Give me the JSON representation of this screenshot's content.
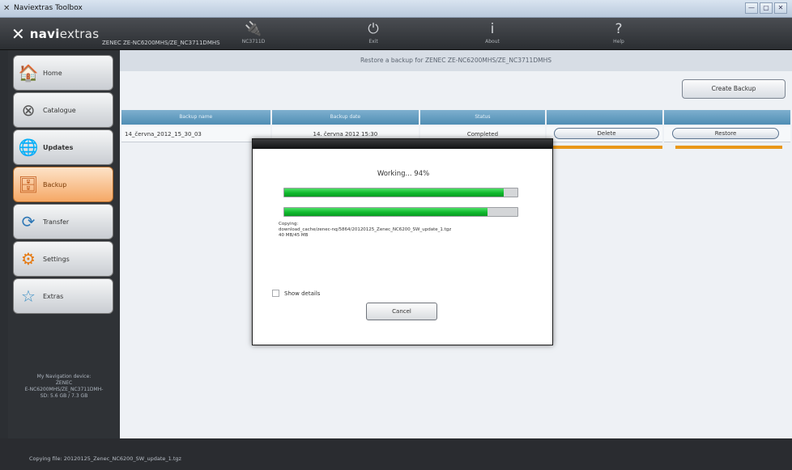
{
  "window": {
    "title": "Naviextras Toolbox",
    "min": "—",
    "max": "▢",
    "close": "✕"
  },
  "topbar": {
    "logo_prefix": "navi",
    "logo_suffix": "extras",
    "device_name": "ZENEC ZE-NC6200MHS/ZE_NC3711DMHS",
    "items": [
      {
        "icon": "plug-icon",
        "glyph": "🔌",
        "label": "NC3711D"
      },
      {
        "icon": "exit-icon",
        "glyph": "⏻",
        "label": "Exit"
      },
      {
        "icon": "info-icon",
        "glyph": "i",
        "label": "About"
      },
      {
        "icon": "help-icon",
        "glyph": "?",
        "label": "Help"
      }
    ]
  },
  "sidebar": {
    "items": [
      {
        "name": "home",
        "glyph": "🏠",
        "label": "Home",
        "active": false
      },
      {
        "name": "catalogue",
        "glyph": "⊗",
        "label": "Catalogue",
        "active": false
      },
      {
        "name": "updates",
        "glyph": "🌐",
        "label": "Updates",
        "active": false
      },
      {
        "name": "backup",
        "glyph": "🗄",
        "label": "Backup",
        "active": true
      },
      {
        "name": "transfer",
        "glyph": "⟳",
        "label": "Transfer",
        "active": false
      },
      {
        "name": "settings",
        "glyph": "⚙",
        "label": "Settings",
        "active": false
      },
      {
        "name": "extras",
        "glyph": "☆",
        "label": "Extras",
        "active": false
      }
    ],
    "device_info_line1": "My Navigation device:",
    "device_info_line2": "ZENEC",
    "device_info_line3": "E-NC6200MHS/ZE_NC3711DMH-",
    "device_info_line4": "SD: 5.6 GB / 7.3 GB"
  },
  "main": {
    "header": "Restore a backup for ZENEC ZE-NC6200MHS/ZE_NC3711DMHS",
    "create_backup": "Create Backup",
    "columns": [
      "Backup name",
      "Backup date",
      "Status",
      "",
      ""
    ],
    "row": {
      "name": "14_června_2012_15_30_03",
      "date": "14. června 2012 15:30",
      "status": "Completed",
      "delete": "Delete",
      "restore": "Restore"
    }
  },
  "dialog": {
    "working": "Working... 94%",
    "progress1": 0.94,
    "progress2": 0.87,
    "copying_label": "Copying:",
    "copying_file": "download_cache/zenec-nq/5864/20120125_Zenec_NC6200_SW_update_1.tgz",
    "copying_size": "40 MB/45 MB",
    "show_details": "Show details",
    "cancel": "Cancel"
  },
  "statusbar": {
    "text": "Copying file: 20120125_Zenec_NC6200_SW_update_1.tgz"
  }
}
